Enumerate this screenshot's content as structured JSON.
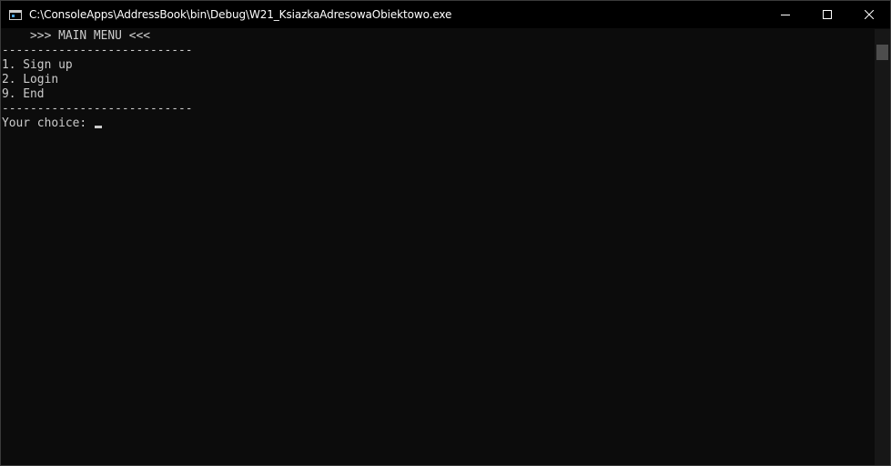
{
  "window": {
    "title": "C:\\ConsoleApps\\AddressBook\\bin\\Debug\\W21_KsiazkaAdresowaObiektowo.exe"
  },
  "console": {
    "lines": [
      "    >>> MAIN MENU <<<",
      "---------------------------",
      "1. Sign up",
      "2. Login",
      "9. End",
      "---------------------------"
    ],
    "prompt": "Your choice: "
  },
  "icons": {
    "app": "console-app-icon",
    "minimize": "minimize-icon",
    "maximize": "maximize-icon",
    "close": "close-icon"
  },
  "colors": {
    "background": "#0c0c0c",
    "text": "#cccccc",
    "titlebar": "#000000"
  }
}
